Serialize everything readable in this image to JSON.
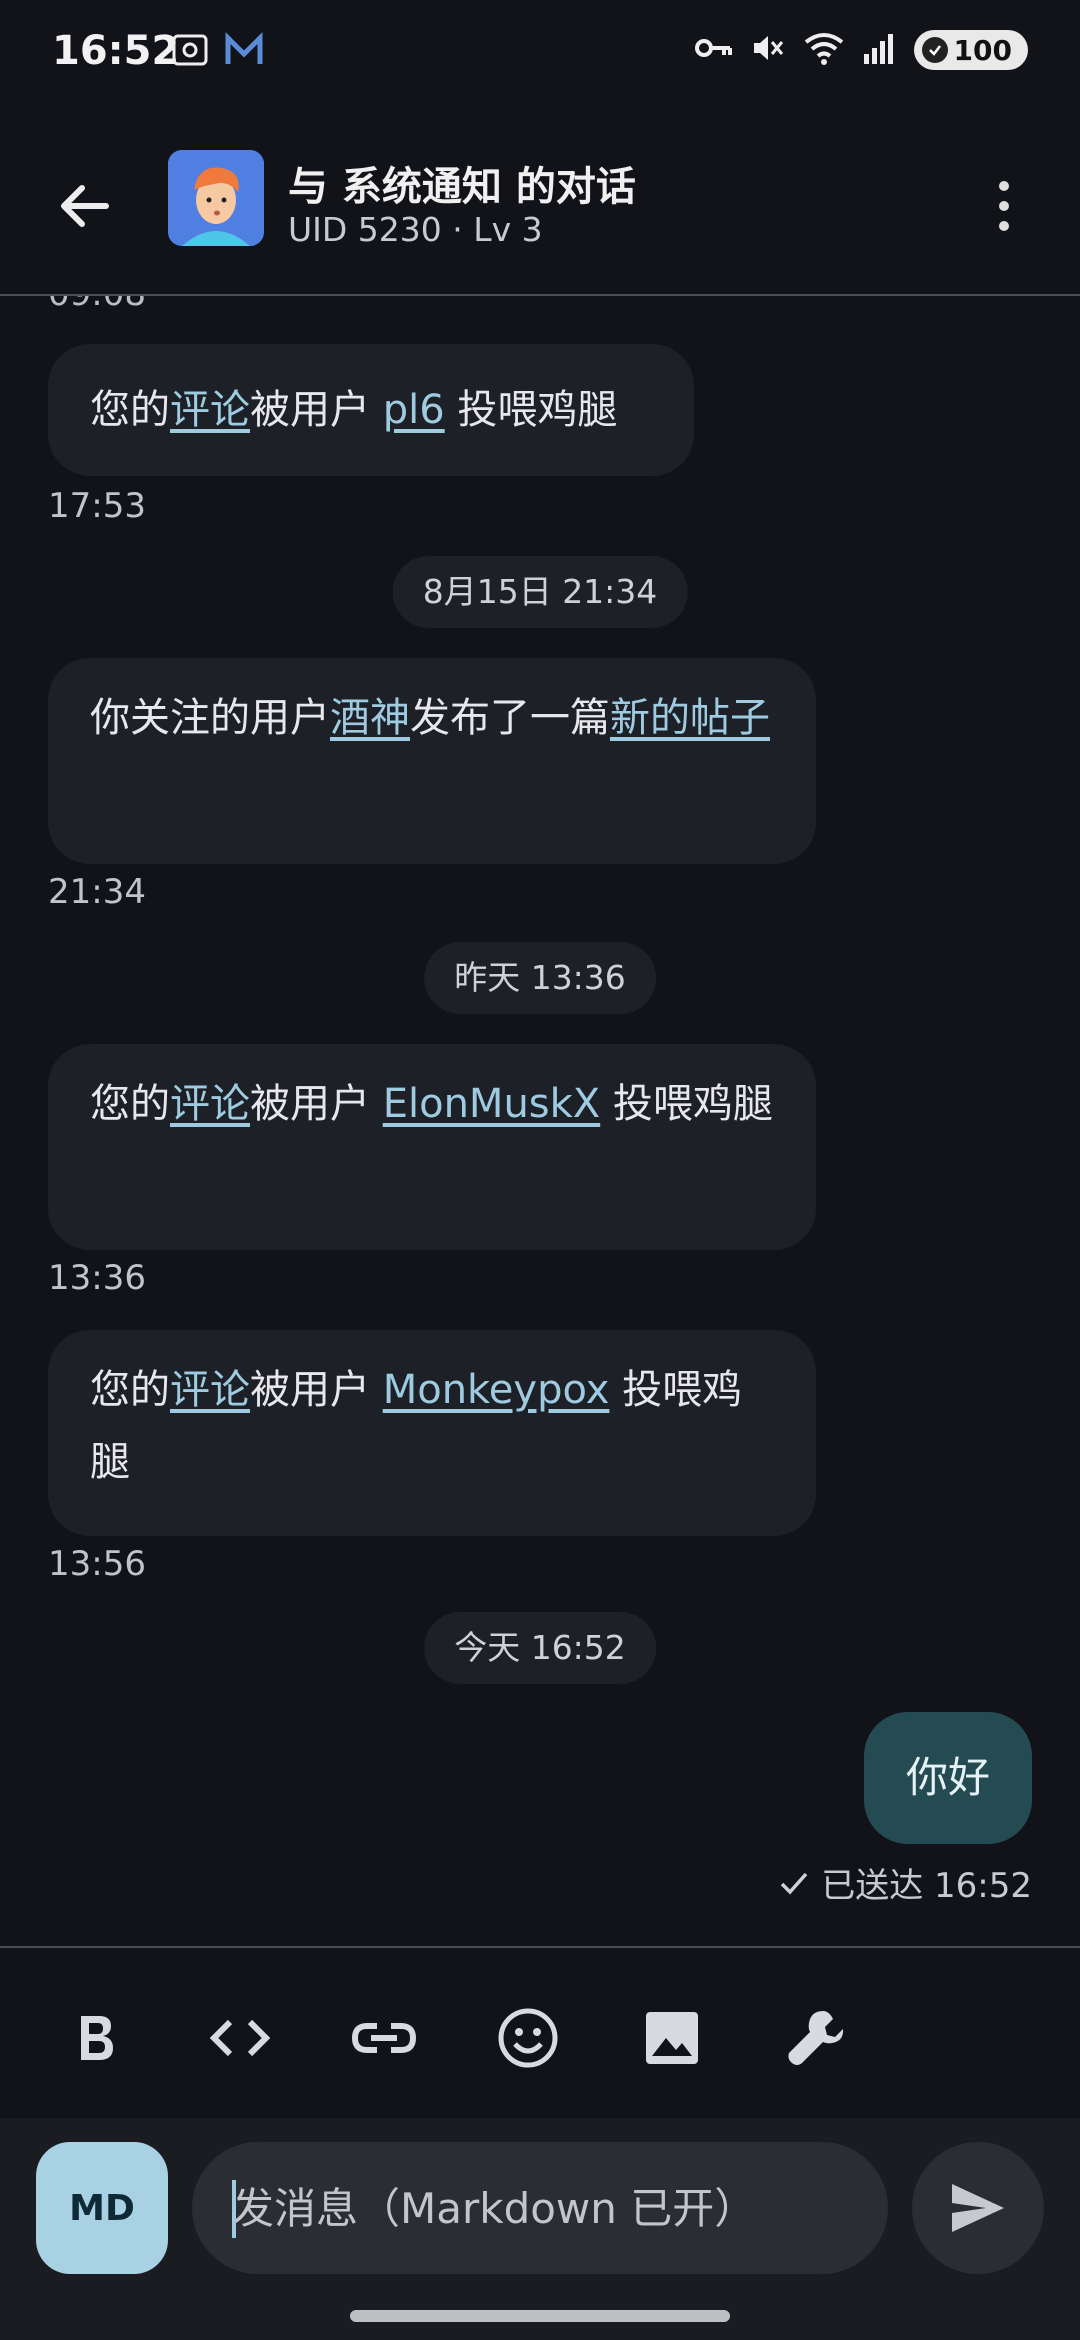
{
  "status_bar": {
    "time": "16:52",
    "battery": "100"
  },
  "header": {
    "title": "与 系统通知 的对话",
    "subtitle": "UID 5230 · Lv 3"
  },
  "messages": {
    "cut_timestamp": "09:08",
    "m1": {
      "pre": "您的",
      "link1": "评论",
      "mid": "被用户 ",
      "link2": "pl6",
      "post": " 投喂鸡腿",
      "time": "17:53"
    },
    "chip1": "8月15日 21:34",
    "m2": {
      "pre": "你关注的用户",
      "link1": "酒神",
      "mid": "发布了一篇",
      "link2": "新的帖子",
      "time": "21:34"
    },
    "chip2": "昨天 13:36",
    "m3": {
      "pre": "您的",
      "link1": "评论",
      "mid": "被用户 ",
      "link2": "ElonMuskX",
      "post": " 投喂鸡腿",
      "time": "13:36"
    },
    "m4": {
      "pre": "您的",
      "link1": "评论",
      "mid": "被用户 ",
      "link2": "Monkeypox",
      "post": " 投喂鸡腿",
      "time": "13:56"
    },
    "chip3": "今天 16:52",
    "mine": {
      "text": "你好",
      "status": "已送达 16:52"
    }
  },
  "toolbar": {
    "items": [
      "bold-icon",
      "code-icon",
      "link-icon",
      "emoji-icon",
      "image-icon",
      "wrench-icon"
    ]
  },
  "input": {
    "md_label": "MD",
    "placeholder": "发消息（Markdown 已开）"
  },
  "colors": {
    "background": "#111318",
    "bubble": "#1e2027",
    "link": "#9ecbe0",
    "own_bubble": "#244a52",
    "md_button": "#a8d2e3"
  }
}
